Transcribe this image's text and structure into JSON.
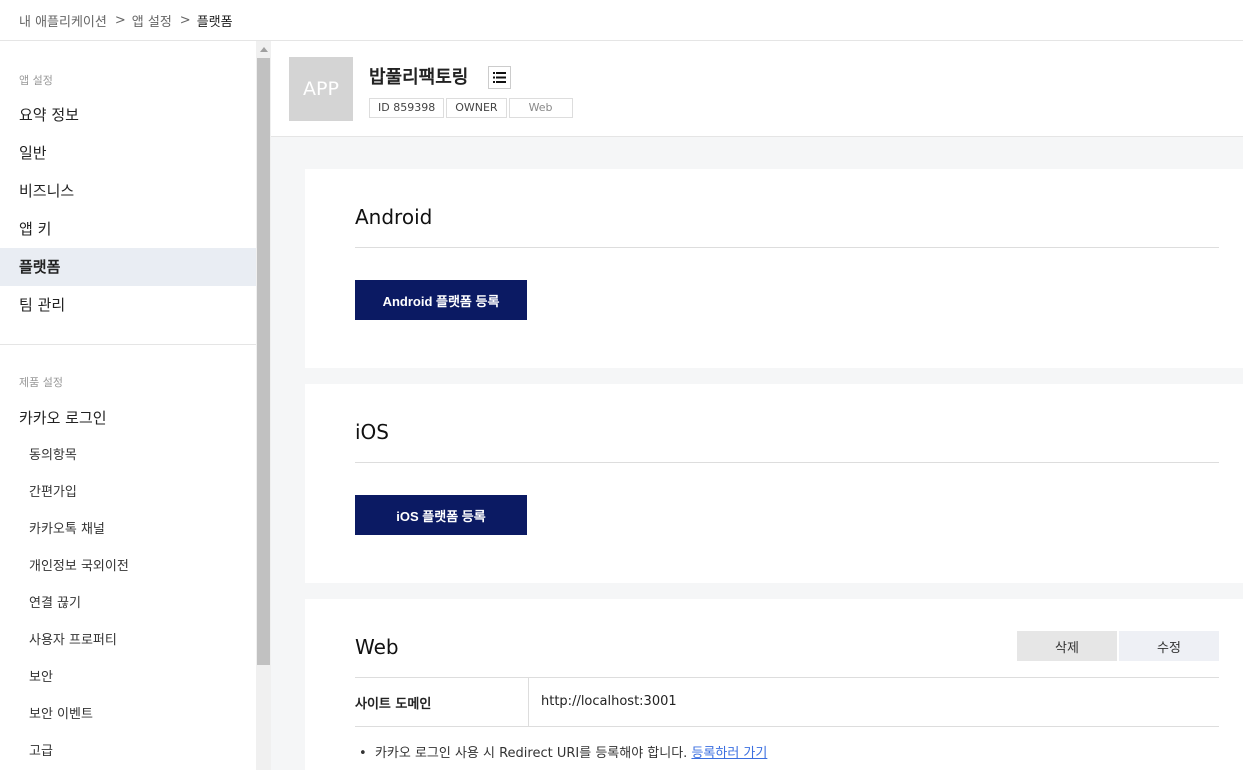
{
  "breadcrumb": {
    "items": [
      "내 애플리케이션",
      "앱 설정",
      "플랫폼"
    ],
    "separator": ">"
  },
  "sidebar": {
    "app_section_label": "앱 설정",
    "app_items": [
      {
        "label": "요약 정보"
      },
      {
        "label": "일반"
      },
      {
        "label": "비즈니스"
      },
      {
        "label": "앱 키"
      },
      {
        "label": "플랫폼",
        "active": true
      },
      {
        "label": "팀 관리"
      }
    ],
    "product_section_label": "제품 설정",
    "product_group_label": "카카오 로그인",
    "product_subitems": [
      {
        "label": "동의항목"
      },
      {
        "label": "간편가입"
      },
      {
        "label": "카카오톡 채널"
      },
      {
        "label": "개인정보 국외이전"
      },
      {
        "label": "연결 끊기"
      },
      {
        "label": "사용자 프로퍼티"
      },
      {
        "label": "보안"
      },
      {
        "label": "보안 이벤트"
      },
      {
        "label": "고급"
      }
    ]
  },
  "app": {
    "thumb_text": "APP",
    "name": "밥풀리팩토링",
    "tags": [
      "ID 859398",
      "OWNER",
      "Web"
    ],
    "list_icon": "list-icon"
  },
  "platforms": {
    "android": {
      "title": "Android",
      "register_label": "Android 플랫폼 등록"
    },
    "ios": {
      "title": "iOS",
      "register_label": "iOS 플랫폼 등록"
    },
    "web": {
      "title": "Web",
      "delete_label": "삭제",
      "edit_label": "수정",
      "site_domain_label": "사이트 도메인",
      "site_domain_value": "http://localhost:3001",
      "note_text": "카카오 로그인 사용 시 Redirect URI를 등록해야 합니다.",
      "note_link": "등록하러 가기"
    }
  },
  "colors": {
    "primary": "#0b1a63",
    "active_bg": "#e9edf3",
    "link": "#3b6fe0"
  }
}
